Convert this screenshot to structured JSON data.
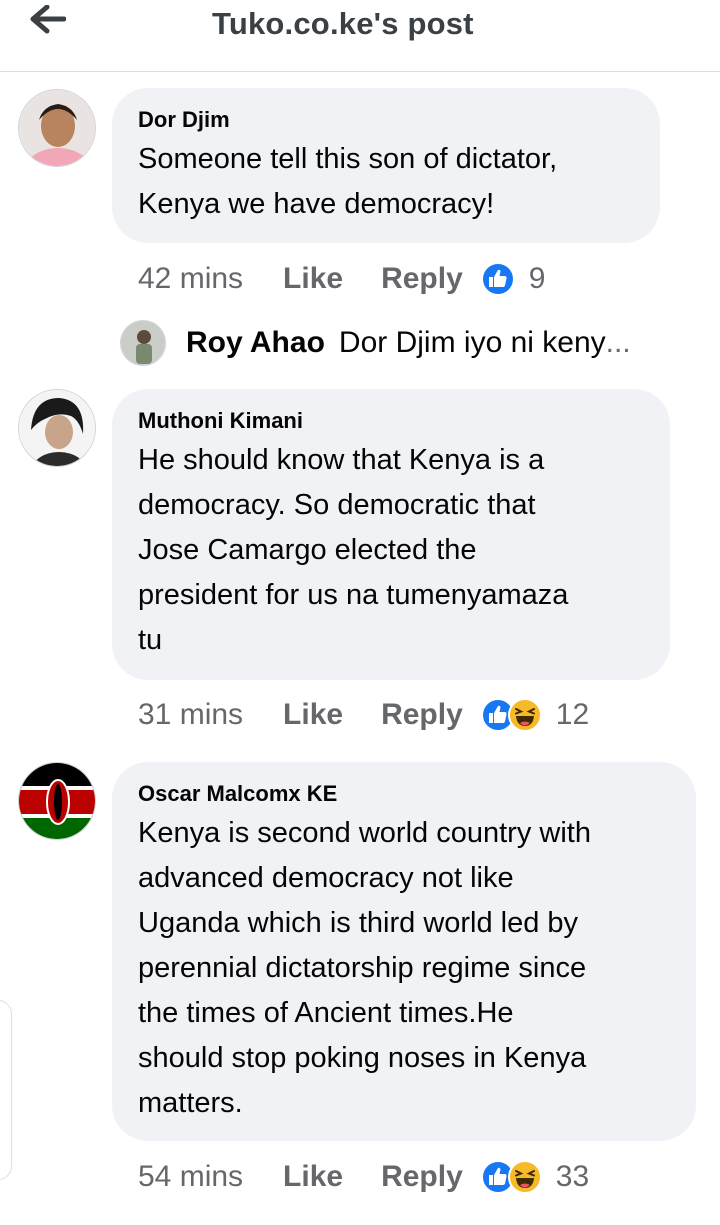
{
  "header": {
    "title": "Tuko.co.ke's post",
    "back_icon": "arrow-left-icon"
  },
  "comments": [
    {
      "author": "Dor Djim",
      "text": "Someone tell this son of dictator,\nKenya we have democracy!",
      "time": "42 mins",
      "like_label": "Like",
      "reply_label": "Reply",
      "reactions": [
        "like-reaction-icon"
      ],
      "reaction_count": "9"
    },
    {
      "author": "Muthoni Kimani",
      "text": "He should know that Kenya is a\ndemocracy. So democratic that\nJose Camargo elected the\npresident for us na tumenyamaza\ntu",
      "time": "31 mins",
      "like_label": "Like",
      "reply_label": "Reply",
      "reactions": [
        "like-reaction-icon",
        "haha-reaction-icon"
      ],
      "reaction_count": "12"
    },
    {
      "author": "Oscar Malcomx KE",
      "text": "Kenya is second world country with\nadvanced democracy not like\nUganda which is third world led by\nperennial dictatorship regime since\nthe times of Ancient times.He\nshould stop poking noses in Kenya\nmatters.",
      "time": "54 mins",
      "like_label": "Like",
      "reply_label": "Reply",
      "reactions": [
        "like-reaction-icon",
        "haha-reaction-icon"
      ],
      "reaction_count": "33"
    }
  ],
  "reply_preview": {
    "author": "Roy Ahao",
    "snippet": "Dor Djim iyo ni keny",
    "ellipsis": "..."
  },
  "colors": {
    "bubble": "#f0f2f5",
    "meta_text": "#65676b",
    "like_blue": "#1877f2",
    "haha_yellow": "#f7b928"
  }
}
